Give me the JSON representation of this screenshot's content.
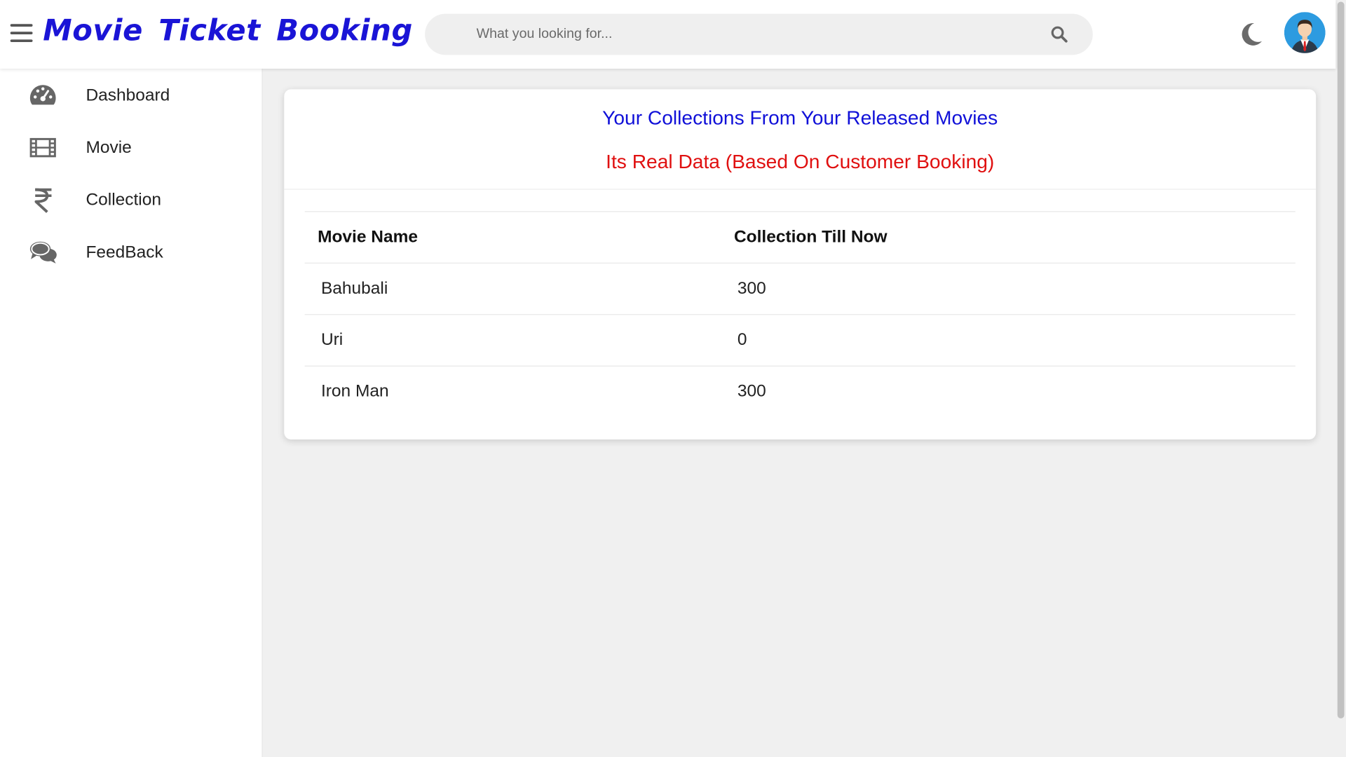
{
  "header": {
    "brand": "Movie Ticket Booking",
    "search_placeholder": "What you looking for..."
  },
  "icons": {
    "menu": "hamburger-icon",
    "search": "search-icon",
    "theme": "moon-icon",
    "avatar": "user-avatar"
  },
  "sidebar": {
    "items": [
      {
        "label": "Dashboard",
        "icon": "speedometer-icon"
      },
      {
        "label": "Movie",
        "icon": "film-icon"
      },
      {
        "label": "Collection",
        "icon": "rupee-icon"
      },
      {
        "label": "FeedBack",
        "icon": "comments-icon"
      }
    ]
  },
  "main": {
    "title": "Your Collections From Your Released Movies",
    "subtitle": "Its Real Data (Based On Customer Booking)",
    "table": {
      "headers": [
        "Movie Name",
        "Collection Till Now"
      ],
      "rows": [
        [
          "Bahubali",
          "300"
        ],
        [
          "Uri",
          "0"
        ],
        [
          "Iron Man",
          "300"
        ]
      ]
    }
  },
  "colors": {
    "brand": "#1a14d6",
    "title": "#1010d8",
    "subtitle": "#e01010",
    "icon_gray": "#666666"
  }
}
